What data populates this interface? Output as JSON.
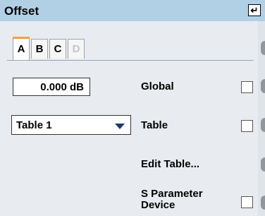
{
  "header": {
    "title": "Offset",
    "enter_icon": "enter-return-icon"
  },
  "tabs": [
    {
      "label": "A",
      "state": "active"
    },
    {
      "label": "B",
      "state": "normal"
    },
    {
      "label": "C",
      "state": "normal"
    },
    {
      "label": "D",
      "state": "disabled"
    }
  ],
  "offset_value": "0.000 dB",
  "table_select": {
    "selected": "Table 1"
  },
  "rows": {
    "global": {
      "label": "Global",
      "checked": false
    },
    "table": {
      "label": "Table",
      "checked": false
    },
    "edit_table": {
      "label": "Edit Table..."
    },
    "s_param": {
      "label_line1": "S Parameter",
      "label_line2": "Device",
      "checked": false
    }
  },
  "colors": {
    "title_bar": "#b1d0e5",
    "active_tab_accent": "#f2a23a",
    "background": "#e8ecf0"
  }
}
